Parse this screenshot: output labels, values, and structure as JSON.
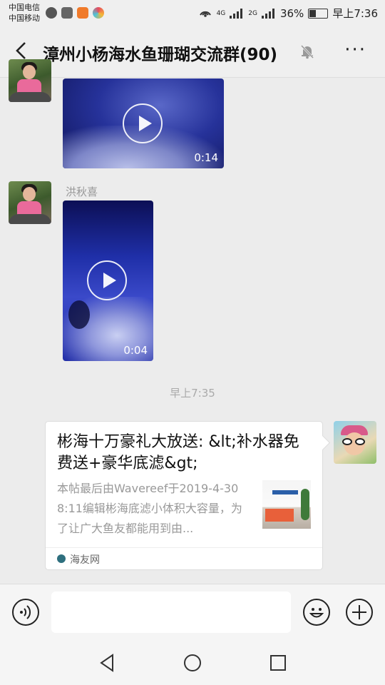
{
  "status_bar": {
    "carrier_1": "中国电信",
    "carrier_2": "中国移动",
    "net_1": "4G",
    "net_2": "2G",
    "battery": "36%",
    "time": "早上7:36"
  },
  "header": {
    "title": "漳州小杨海水鱼珊瑚交流群(90)",
    "more_label": "···"
  },
  "messages": {
    "video_1_duration": "0:14",
    "video_2_sender": "洪秋喜",
    "video_2_duration": "0:04",
    "timestamp": "早上7:35",
    "link_card": {
      "title": "彬海十万豪礼大放送: &lt;补水器免费送+豪华底滤&gt;",
      "description": "本帖最后由Wavereef于2019-4-308:11编辑彬海底滤小体积大容量，为了让广大鱼友都能用到由...",
      "source": "海友网"
    }
  },
  "colors": {
    "background": "#ececec",
    "video_blue": "#1f2fa8"
  },
  "icons": [
    "back-arrow-icon",
    "mute-bell-icon",
    "more-icon",
    "voice-icon",
    "emoji-icon",
    "plus-icon",
    "nav-back-icon",
    "nav-home-icon",
    "nav-recents-icon"
  ]
}
